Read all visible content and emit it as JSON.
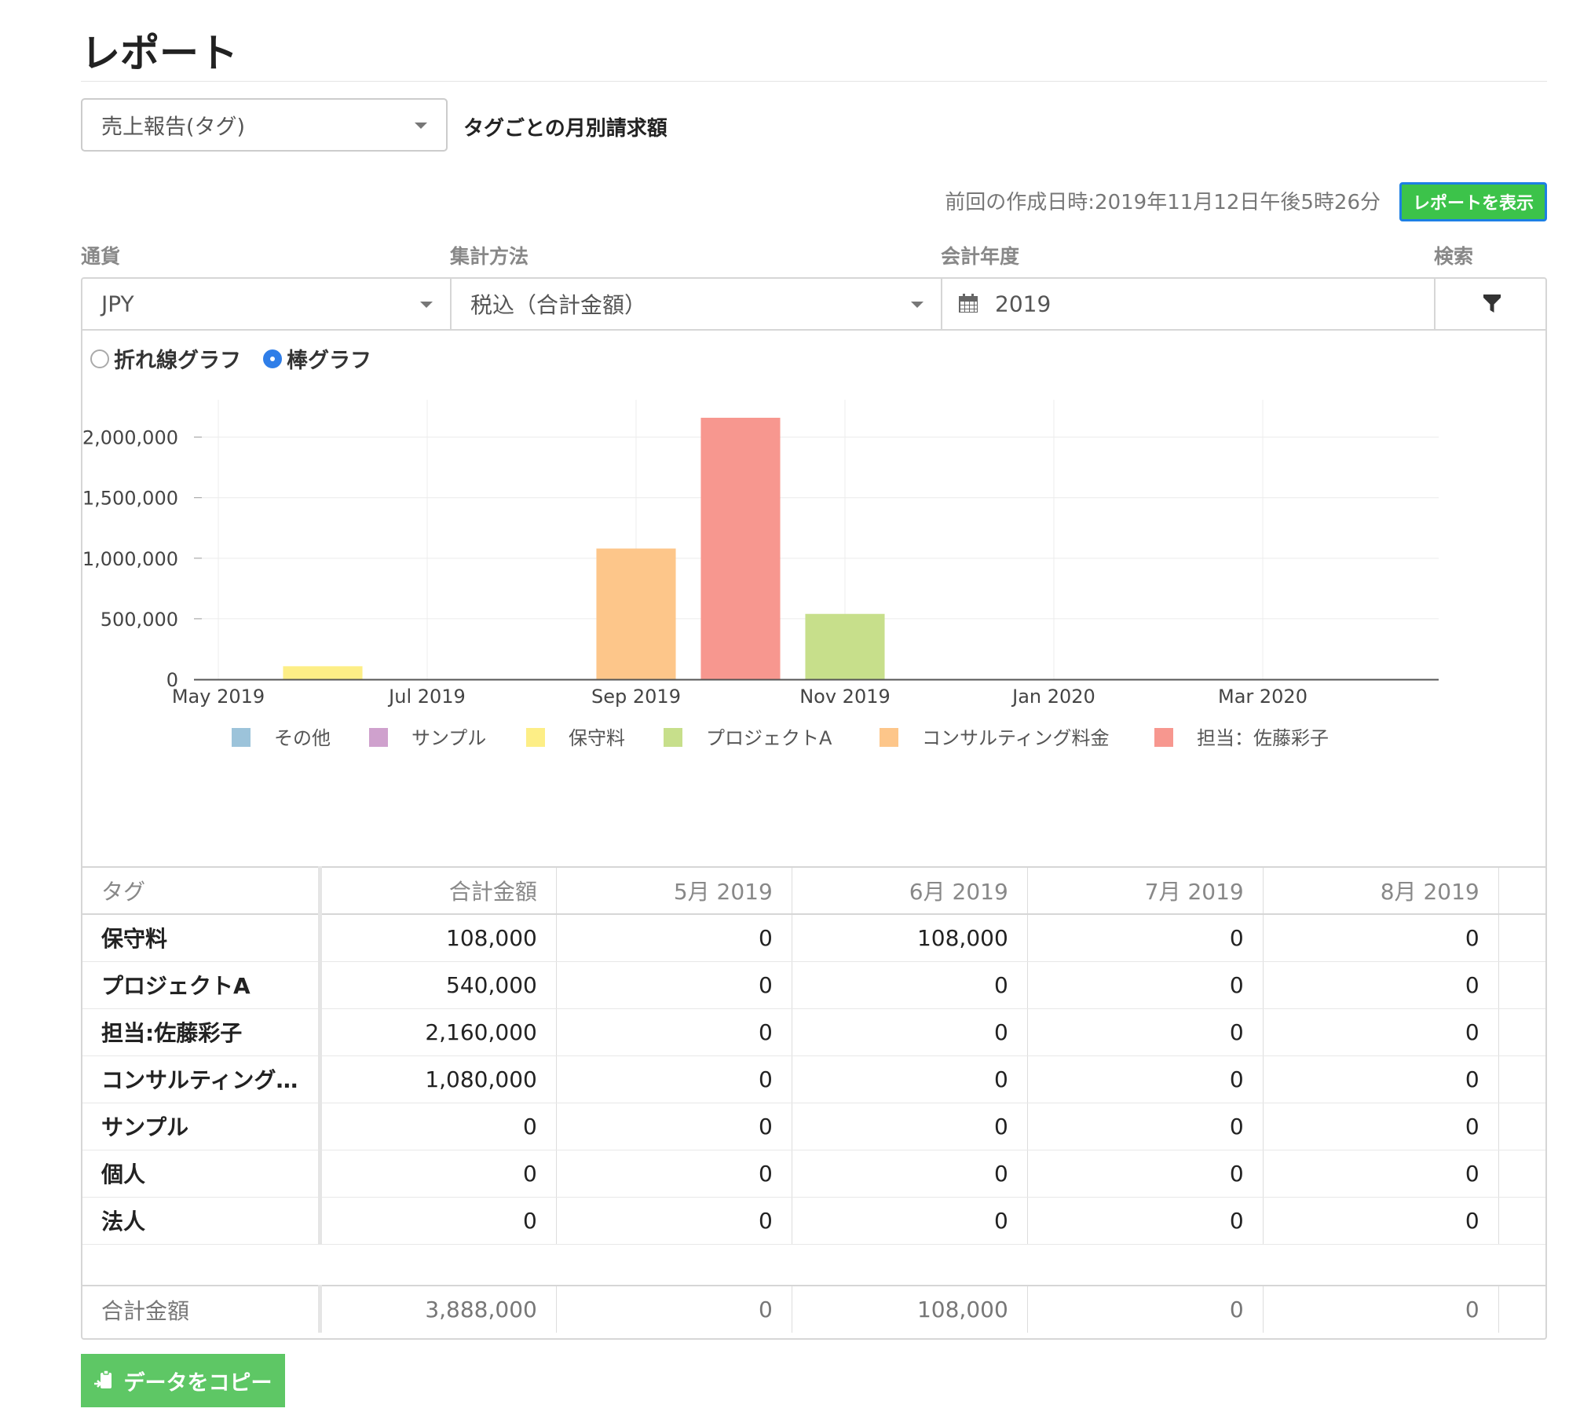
{
  "page": {
    "title": "レポート"
  },
  "report_select": {
    "value": "売上報告(タグ)",
    "description": "タグごとの月別請求額"
  },
  "status": {
    "last_created": "前回の作成日時:2019年11月12日午後5時26分",
    "show_button": "レポートを表示"
  },
  "filters": {
    "currency": {
      "label": "通貨",
      "value": "JPY"
    },
    "method": {
      "label": "集計方法",
      "value": "税込（合計金額）"
    },
    "fiscal_year": {
      "label": "会計年度",
      "value": "2019"
    },
    "search": {
      "label": "検索"
    }
  },
  "chart_toggle": {
    "line_label": "折れ線グラフ",
    "bar_label": "棒グラフ",
    "selected": "bar"
  },
  "chart_data": {
    "type": "bar",
    "x_ticks": [
      "May 2019",
      "Jul 2019",
      "Sep 2019",
      "Nov 2019",
      "Jan 2020",
      "Mar 2020"
    ],
    "y_ticks": [
      "0",
      "500,000",
      "1,000,000",
      "1,500,000",
      "2,000,000"
    ],
    "ylim": [
      0,
      2270000
    ],
    "grid": true,
    "legend_position": "bottom",
    "series": [
      {
        "name": "その他",
        "color": "#9cc3da",
        "month": "",
        "value": 0
      },
      {
        "name": "サンプル",
        "color": "#cfa1cd",
        "month": "",
        "value": 0
      },
      {
        "name": "保守料",
        "color": "#fdee86",
        "month": "Jun 2019",
        "value": 108000
      },
      {
        "name": "プロジェクトA",
        "color": "#c7df8b",
        "month": "Nov 2019",
        "value": 540000
      },
      {
        "name": "コンサルティング料金",
        "color": "#fdc68a",
        "month": "Sep 2019",
        "value": 1080000
      },
      {
        "name": "担当：佐藤彩子",
        "color": "#f7978f",
        "month": "Oct 2019",
        "value": 2160000
      }
    ]
  },
  "table": {
    "columns": [
      "タグ",
      "合計金額",
      "5月 2019",
      "6月 2019",
      "7月 2019",
      "8月 2019"
    ],
    "rows": [
      [
        "保守料",
        "108,000",
        "0",
        "108,000",
        "0",
        "0"
      ],
      [
        "プロジェクトA",
        "540,000",
        "0",
        "0",
        "0",
        "0"
      ],
      [
        "担当:佐藤彩子",
        "2,160,000",
        "0",
        "0",
        "0",
        "0"
      ],
      [
        "コンサルティング…",
        "1,080,000",
        "0",
        "0",
        "0",
        "0"
      ],
      [
        "サンプル",
        "0",
        "0",
        "0",
        "0",
        "0"
      ],
      [
        "個人",
        "0",
        "0",
        "0",
        "0",
        "0"
      ],
      [
        "法人",
        "0",
        "0",
        "0",
        "0",
        "0"
      ]
    ],
    "total": [
      "合計金額",
      "3,888,000",
      "0",
      "108,000",
      "0",
      "0"
    ]
  },
  "copy_button": {
    "label": "データをコピー"
  }
}
